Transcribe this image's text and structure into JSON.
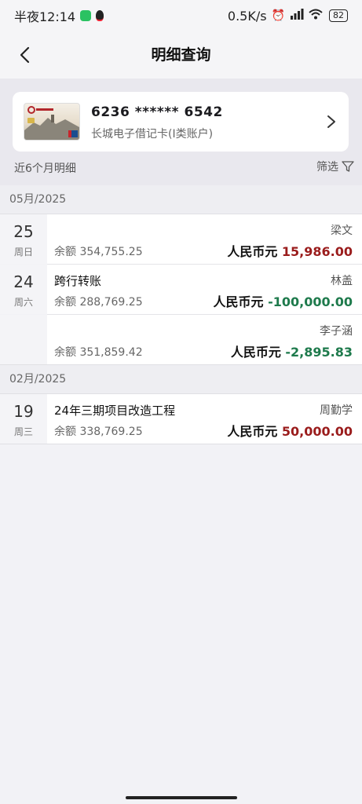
{
  "status_bar": {
    "time": "半夜12:14",
    "speed": "0.5K/s",
    "battery": "82",
    "network": "HD"
  },
  "nav": {
    "title": "明细查询"
  },
  "account": {
    "number": "6236 ****** 6542",
    "type": "长城电子借记卡(I类账户)"
  },
  "list_header": {
    "range": "近6个月明细",
    "filter": "筛选"
  },
  "groups": [
    {
      "month": "05月/2025",
      "transactions": [
        {
          "day": "25",
          "weekday": "周日",
          "desc": "",
          "balance": "余额 354,755.25",
          "counterparty": "梁文",
          "currency": "人民币元",
          "amount": "15,986.00",
          "sign": "pos"
        },
        {
          "day": "24",
          "weekday": "周六",
          "desc": "跨行转账",
          "balance": "余额 288,769.25",
          "counterparty": "林盖",
          "currency": "人民币元",
          "amount": "-100,000.00",
          "sign": "neg"
        },
        {
          "day": "",
          "weekday": "",
          "desc": "",
          "balance": "余额 351,859.42",
          "counterparty": "李子涵",
          "currency": "人民币元",
          "amount": "-2,895.83",
          "sign": "neg"
        }
      ]
    },
    {
      "month": "02月/2025",
      "transactions": [
        {
          "day": "19",
          "weekday": "周三",
          "desc": "24年三期项目改造工程",
          "balance": "余额 338,769.25",
          "counterparty": "周勤学",
          "currency": "人民币元",
          "amount": "50,000.00",
          "sign": "pos"
        }
      ]
    }
  ],
  "colors": {
    "positive": "#9a1c1c",
    "negative": "#1e7a4c"
  }
}
